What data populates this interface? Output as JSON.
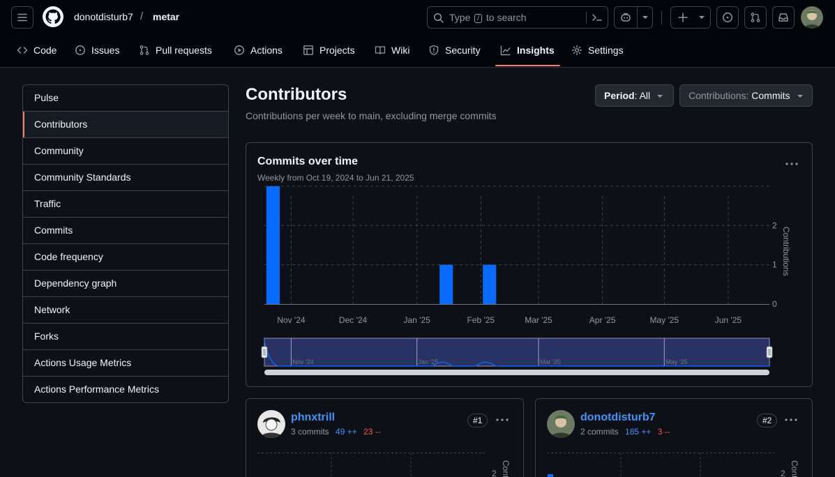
{
  "header": {
    "owner": "donotdisturb7",
    "separator": "/",
    "repo": "metar",
    "search_prefix": "Type",
    "search_key": "/",
    "search_suffix": "to search",
    "icons": [
      "menu-icon",
      "github-logo-icon",
      "search-icon",
      "command-palette-icon",
      "copilot-icon",
      "plus-icon",
      "issues-icon",
      "pull-requests-icon",
      "inbox-icon"
    ]
  },
  "tabs": [
    {
      "label": "Code",
      "icon": "code-icon"
    },
    {
      "label": "Issues",
      "icon": "issue-icon"
    },
    {
      "label": "Pull requests",
      "icon": "git-pull-request-icon"
    },
    {
      "label": "Actions",
      "icon": "play-icon"
    },
    {
      "label": "Projects",
      "icon": "table-icon"
    },
    {
      "label": "Wiki",
      "icon": "book-icon"
    },
    {
      "label": "Security",
      "icon": "shield-icon"
    },
    {
      "label": "Insights",
      "icon": "graph-icon",
      "active": true
    },
    {
      "label": "Settings",
      "icon": "gear-icon"
    }
  ],
  "sidebar": {
    "items": [
      {
        "label": "Pulse"
      },
      {
        "label": "Contributors",
        "active": true
      },
      {
        "label": "Community"
      },
      {
        "label": "Community Standards"
      },
      {
        "label": "Traffic"
      },
      {
        "label": "Commits"
      },
      {
        "label": "Code frequency"
      },
      {
        "label": "Dependency graph"
      },
      {
        "label": "Network"
      },
      {
        "label": "Forks"
      },
      {
        "label": "Actions Usage Metrics"
      },
      {
        "label": "Actions Performance Metrics"
      }
    ]
  },
  "main": {
    "title": "Contributors",
    "subtitle": "Contributions per week to main, excluding merge commits",
    "period_label": "Period",
    "period_value": ": All",
    "contrib_label": "Contributions: ",
    "contrib_value": "Commits"
  },
  "overview": {
    "title": "Commits over time",
    "subtitle": "Weekly from Oct 19, 2024 to Jun 21, 2025",
    "accent": "#0a6cff"
  },
  "chart_data": {
    "type": "bar",
    "title": "Commits over time",
    "ylabel": "Contributions",
    "ylim": [
      0,
      3
    ],
    "yticks": [
      0,
      1,
      2
    ],
    "x_labels": [
      "Nov '24",
      "Dec '24",
      "Jan '25",
      "Feb '25",
      "Mar '25",
      "Apr '25",
      "May '25",
      "Jun '25"
    ],
    "navigator_labels": [
      "Nov '24",
      "Jan '25",
      "Mar '25",
      "May '25"
    ],
    "x": [
      "2024-10-20",
      "2025-01-12",
      "2025-02-02"
    ],
    "values": [
      3,
      1,
      1
    ],
    "color": "#0a6cff"
  },
  "contributors": [
    {
      "name": "phnxtrill",
      "commits": "3 commits",
      "additions": "49 ++",
      "deletions": "23 --",
      "rank": "#1",
      "chart_tick": "2",
      "chart_label": "Contr"
    },
    {
      "name": "donotdisturb7",
      "commits": "2 commits",
      "additions": "185 ++",
      "deletions": "3 --",
      "rank": "#2",
      "chart_tick": "2",
      "chart_label": "Contr"
    }
  ]
}
